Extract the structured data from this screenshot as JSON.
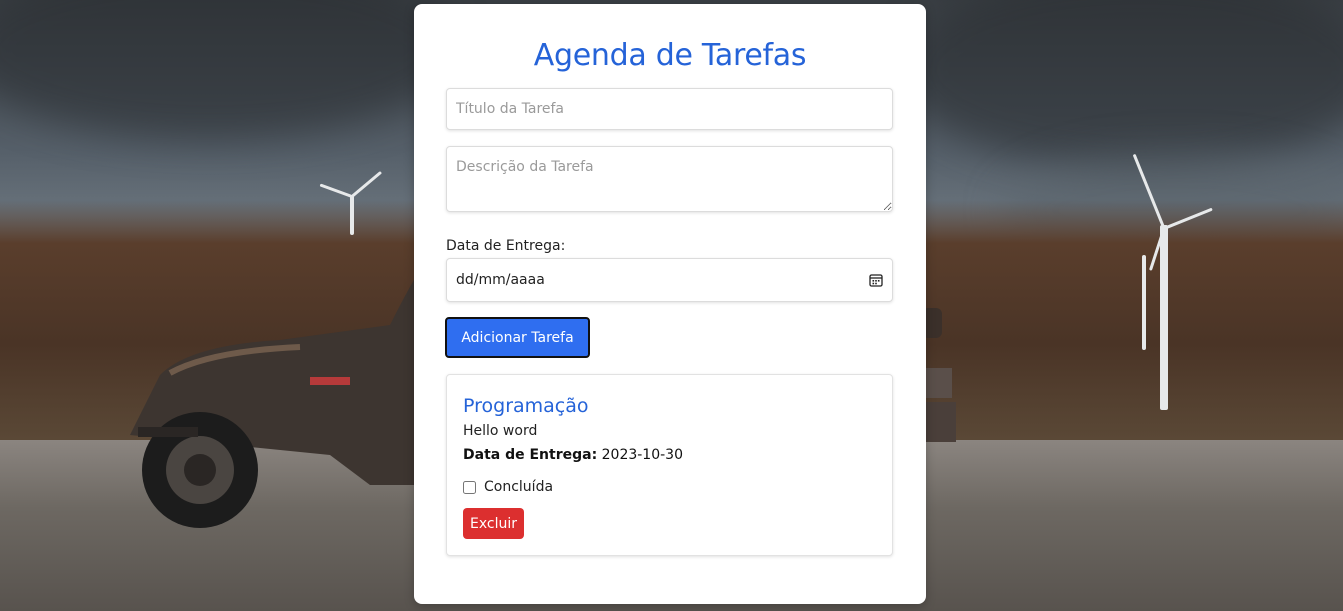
{
  "app": {
    "title": "Agenda de Tarefas"
  },
  "form": {
    "title_placeholder": "Título da Tarefa",
    "description_placeholder": "Descrição da Tarefa",
    "date_label": "Data de Entrega:",
    "date_value": "dd/mm/aaaa",
    "add_button_label": "Adicionar Tarefa"
  },
  "tasks": [
    {
      "title": "Programação",
      "description": "Hello word",
      "due_label": "Data de Entrega:",
      "due_date": "2023-10-30",
      "done_label": "Concluída",
      "done": false,
      "delete_label": "Excluir"
    }
  ],
  "colors": {
    "accent": "#2563d8",
    "add_button": "#2f6ef0",
    "delete_button": "#dc2f2f"
  },
  "icons": {
    "date": "calendar-icon"
  }
}
